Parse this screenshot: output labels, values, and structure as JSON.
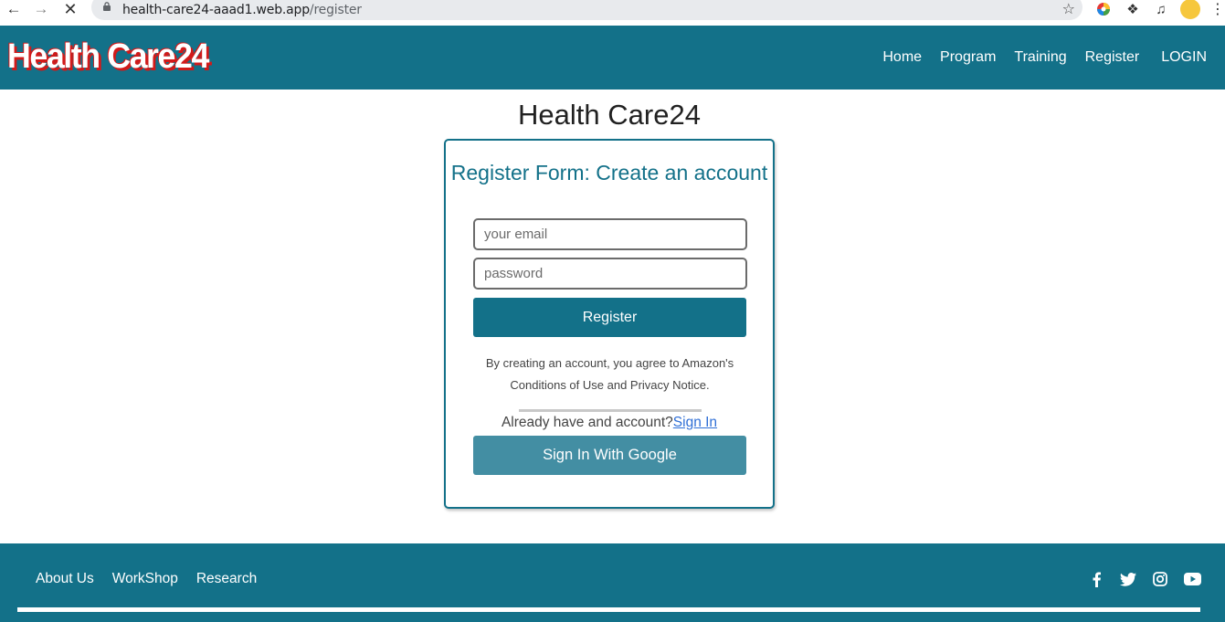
{
  "browser": {
    "url_host": "health-care24-aaad1.web.app",
    "url_path": "/register"
  },
  "header": {
    "logo": "Health Care24",
    "nav": [
      "Home",
      "Program",
      "Training",
      "Register",
      "LOGIN"
    ]
  },
  "main": {
    "title": "Health Care24",
    "form": {
      "title": "Register Form: Create an account",
      "email_placeholder": "your email",
      "password_placeholder": "password",
      "register_label": "Register",
      "terms": "By creating an account, you agree to Amazon's Conditions of Use and Privacy Notice.",
      "already_text": "Already have and account?",
      "sign_in_link": "Sign In",
      "google_label": "Sign In With Google"
    }
  },
  "footer": {
    "links": [
      "About Us",
      "WorkShop",
      "Research"
    ],
    "social_icons": [
      "facebook-icon",
      "twitter-icon",
      "instagram-icon",
      "youtube-icon"
    ]
  },
  "colors": {
    "brand": "#137189",
    "google_button": "#438ea3",
    "logo_shadow": "#d11a1a"
  }
}
